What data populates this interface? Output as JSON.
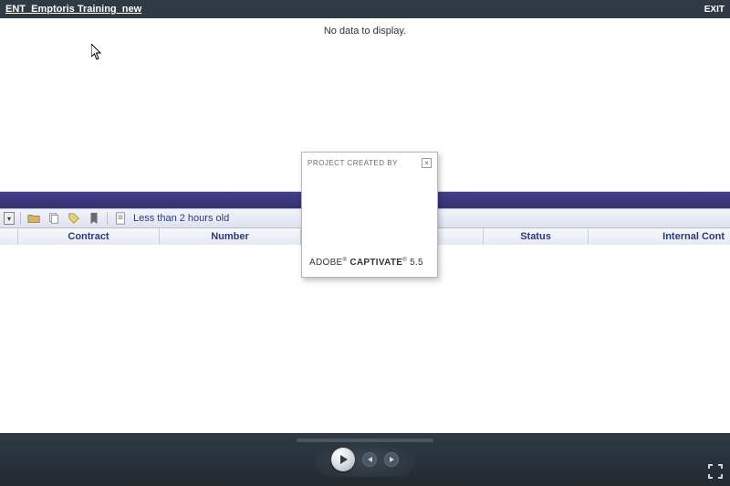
{
  "titlebar": {
    "title": "ENT_Emptoris Training_new",
    "exit": "EXIT"
  },
  "top": {
    "no_data": "No data to display."
  },
  "toolbar": {
    "filter_link": "Less than 2 hours old"
  },
  "columns": {
    "contract": "Contract",
    "number": "Number",
    "status": "Status",
    "internal_contract": "Internal Cont"
  },
  "splash": {
    "heading": "PROJECT CREATED BY",
    "brand_prefix": "ADOBE",
    "product": "CAPTIVATE",
    "version": "5.5",
    "close": "×"
  }
}
